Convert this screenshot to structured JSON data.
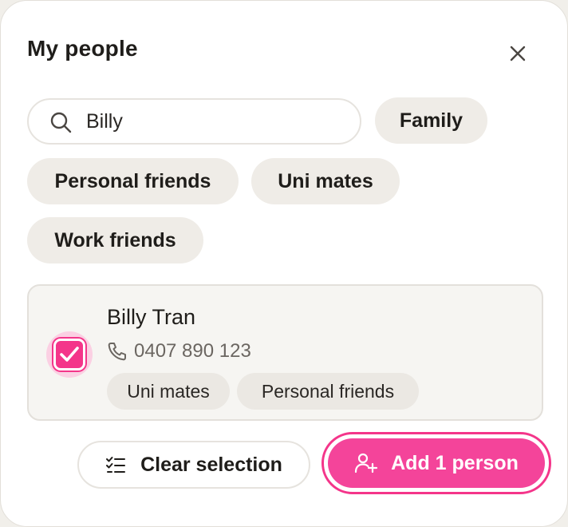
{
  "dialog": {
    "title": "My people",
    "close_icon": "close-icon"
  },
  "search": {
    "value": "Billy",
    "icon": "search-icon"
  },
  "filter_chips": [
    {
      "label": "Family"
    },
    {
      "label": "Personal friends"
    },
    {
      "label": "Uni mates"
    },
    {
      "label": "Work friends"
    }
  ],
  "results": [
    {
      "name": "Billy Tran",
      "phone": "0407 890 123",
      "selected": true,
      "tags": [
        "Uni mates",
        "Personal friends"
      ]
    }
  ],
  "actions": {
    "clear_label": "Clear selection",
    "clear_icon": "checklist-icon",
    "add_label": "Add 1 person",
    "add_icon": "user-plus-icon"
  },
  "colors": {
    "accent": "#f4358a",
    "chip_bg": "#efece7",
    "card_bg": "#f6f5f2"
  }
}
